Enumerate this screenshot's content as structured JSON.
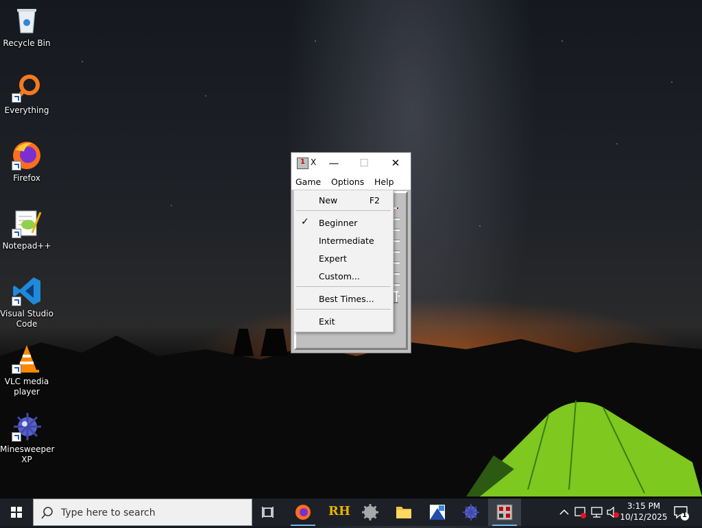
{
  "desktop": {
    "icons": [
      {
        "label": "Recycle Bin"
      },
      {
        "label": "Everything"
      },
      {
        "label": "Firefox"
      },
      {
        "label": "Notepad++"
      },
      {
        "label": "Visual Studio Code"
      },
      {
        "label": "VLC media player"
      },
      {
        "label": "Minesweeper XP"
      }
    ]
  },
  "window": {
    "title": "X",
    "controls": {
      "minimize": "—",
      "maximize": "☐",
      "close": "✕"
    },
    "menus": [
      "Game",
      "Options",
      "Help"
    ]
  },
  "game_menu": {
    "new_label": "New",
    "new_shortcut": "F2",
    "beginner": "Beginner",
    "beginner_check": "✓",
    "intermediate": "Intermediate",
    "expert": "Expert",
    "custom": "Custom...",
    "best_times": "Best Times...",
    "exit": "Exit"
  },
  "taskbar": {
    "search_placeholder": "Type here to search",
    "time": "3:15 PM",
    "date": "10/12/2025",
    "notification_count": "1",
    "rh_label": "RH"
  },
  "colors": {
    "taskbar": "#1d2127",
    "accent": "#76b9ed",
    "menu_bg": "#f2f2f2"
  }
}
